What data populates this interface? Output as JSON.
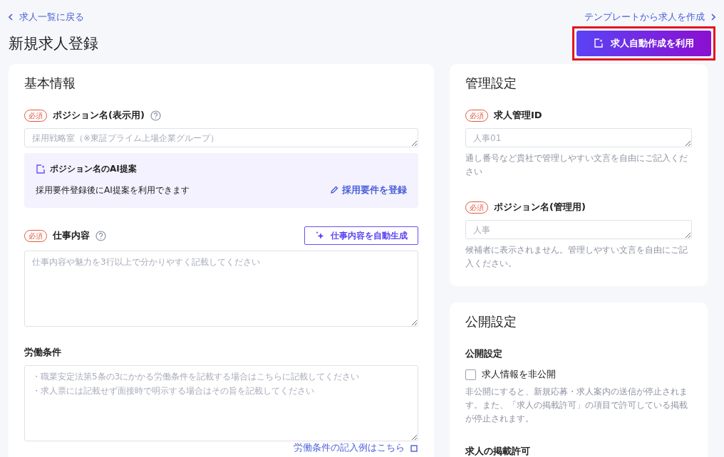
{
  "header": {
    "back_link": "求人一覧に戻る",
    "template_link": "テンプレートから求人を作成",
    "title": "新規求人登録",
    "auto_button": {
      "label": "求人自動作成を利用",
      "highlighted": true
    }
  },
  "basic_info": {
    "title": "基本情報",
    "fields": [
      {
        "kind": "text",
        "badge": "必須",
        "label": "ポジション名(表示用)",
        "help": true,
        "placeholder": "採用戦略室（※東証プライム上場企業グループ）",
        "ai_box": {
          "title": "ポジション名のAI提案",
          "text": "採用要件登録後にAI提案を利用できます",
          "link": "採用要件を登録"
        }
      },
      {
        "kind": "textarea",
        "badge": "必須",
        "label": "仕事内容",
        "help": true,
        "action": "仕事内容を自動生成",
        "placeholder": "仕事内容や魅力を3行以上で分かりやすく記載してください"
      },
      {
        "kind": "textarea",
        "label": "労働条件",
        "placeholder": [
          "・職業安定法第5条の3にかかる労働条件を記載する場合はこちらに記載してください",
          "・求人票には記載せず面接時で明示する場合はその旨を記載してください"
        ],
        "link": "労働条件の記入例はこちら"
      }
    ]
  },
  "management": {
    "title": "管理設定",
    "fields": [
      {
        "kind": "text",
        "badge": "必須",
        "label": "求人管理ID",
        "placeholder": "人事01",
        "hint": "通し番号など貴社で管理しやすい文言を自由にご記入ください"
      },
      {
        "kind": "text",
        "badge": "必須",
        "label": "ポジション名(管理用)",
        "placeholder": "人事",
        "hint": "候補者に表示されません。管理しやすい文言を自由にご記入ください。"
      }
    ]
  },
  "publish": {
    "title": "公開設定",
    "sections": [
      {
        "label": "公開設定",
        "checkbox": {
          "label": "求人情報を非公開",
          "checked": false
        },
        "hint": "非公開にすると、新規応募・求人案内の送信が停止されます。また、「求人の掲載許可」の項目で許可している掲載が停止されます。"
      },
      {
        "label": "求人の掲載許可"
      }
    ]
  }
}
